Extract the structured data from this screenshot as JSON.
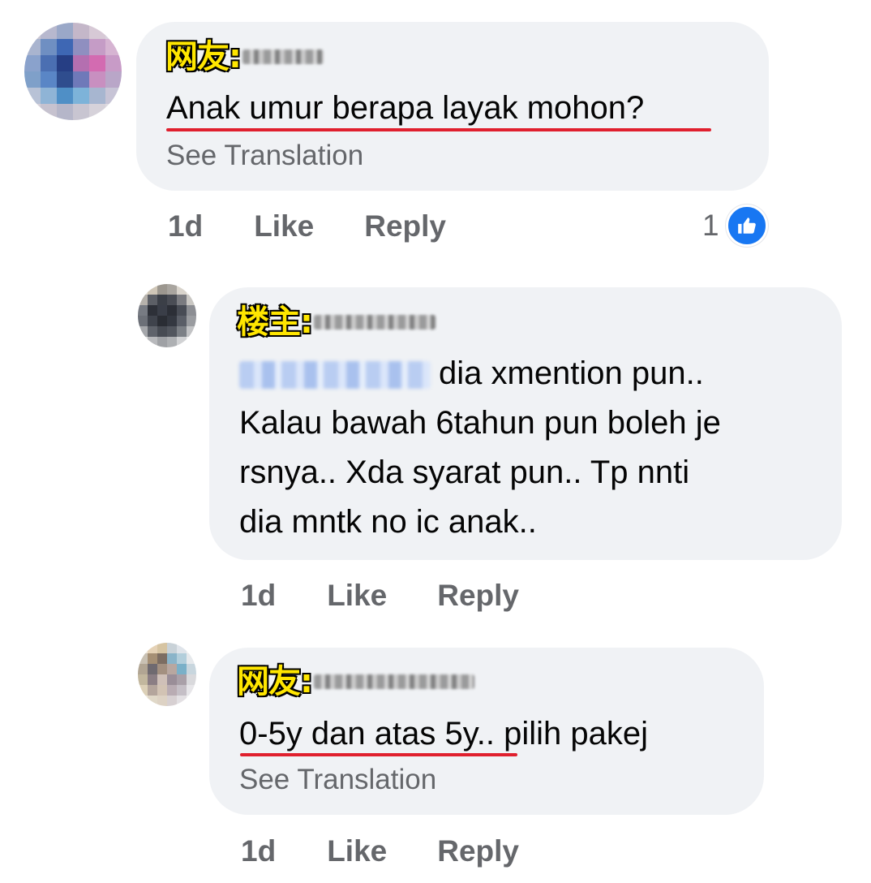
{
  "comments": [
    {
      "role_tag": "网友:",
      "username": "Hanis",
      "text": "Anak umur berapa layak mohon?",
      "see_translation": "See Translation",
      "time": "1d",
      "like": "Like",
      "reply": "Reply",
      "reaction_count": "1",
      "reaction_icon": "thumbs-up-icon"
    },
    {
      "role_tag": "楼主:",
      "username": "Aisyah",
      "mention": "Nurul Huda",
      "lines": [
        "dia xmention pun..",
        "Kalau bawah 6tahun pun boleh je",
        "rsnya.. Xda syarat pun.. Tp nnti",
        "dia mntk no ic anak.."
      ],
      "time": "1d",
      "like": "Like",
      "reply": "Reply"
    },
    {
      "role_tag": "网友:",
      "username": "Nurul Hafiza",
      "text": "0-5y dan atas 5y.. pilih pakej",
      "see_translation": "See Translation",
      "time": "1d",
      "like": "Like",
      "reply": "Reply"
    }
  ],
  "colors": {
    "bubble": "#f0f2f5",
    "secondary_text": "#65676b",
    "underline": "#e0202e",
    "tag_fill": "#ffe600",
    "like_blue": "#1877f2"
  }
}
